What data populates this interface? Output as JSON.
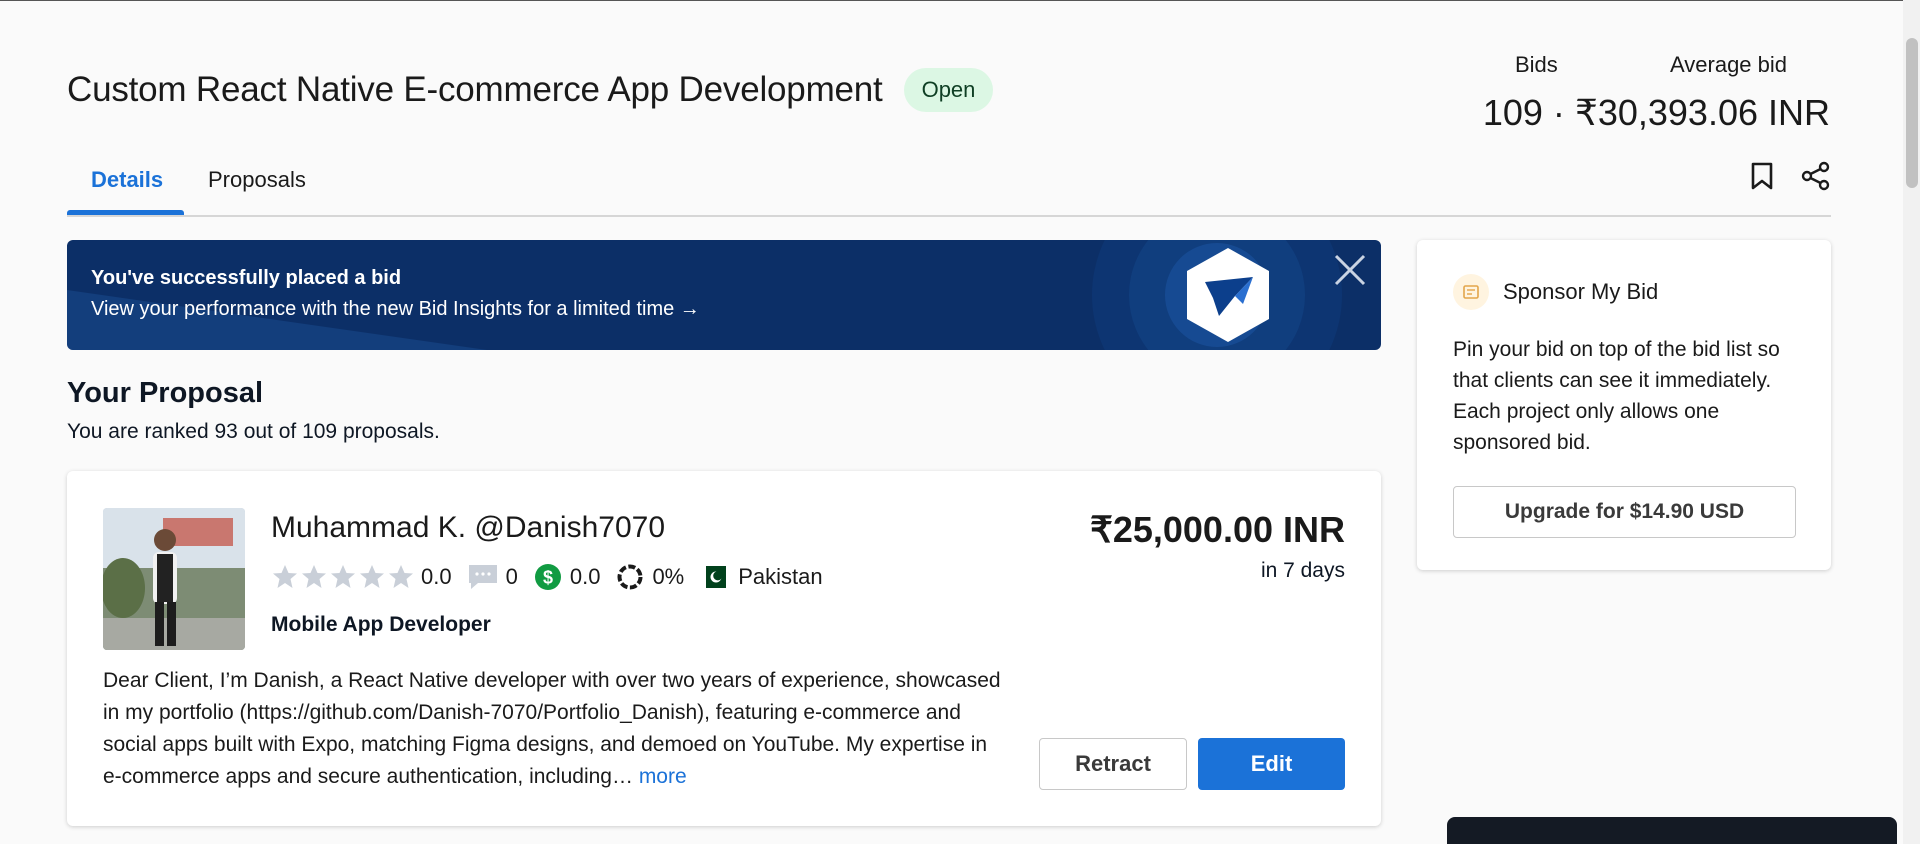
{
  "project": {
    "title": "Custom React Native E-commerce App Development",
    "status": "Open"
  },
  "stats": {
    "bids_label": "Bids",
    "avg_label": "Average bid",
    "bids_count": "109",
    "separator": "·",
    "avg_value": "₹30,393.06 INR"
  },
  "tabs": [
    {
      "label": "Details",
      "active": true
    },
    {
      "label": "Proposals",
      "active": false
    }
  ],
  "banner": {
    "title": "You've successfully placed a bid",
    "subtitle": "View your performance with the new Bid Insights for a limited time →"
  },
  "proposal": {
    "heading": "Your Proposal",
    "rank_text": "You are ranked 93 out of 109 proposals."
  },
  "bid": {
    "name": "Muhammad K.",
    "username": "@Danish7070",
    "rating": "0.0",
    "reviews": "0",
    "earnings": "0.0",
    "completion": "0%",
    "country": "Pakistan",
    "role": "Mobile App Developer",
    "price": "₹25,000.00 INR",
    "delivery": "in 7 days",
    "description": "Dear Client, I’m Danish, a React Native developer with over two years of experience, showcased in my portfolio (https://github.com/Danish-7070/Portfolio_Danish), featuring e-commerce and social apps built with Expo, matching Figma designs, and demoed on YouTube. My expertise in e-commerce apps and secure authentication, including…",
    "more_label": "more",
    "retract_label": "Retract",
    "edit_label": "Edit"
  },
  "sponsor": {
    "title": "Sponsor My Bid",
    "description": "Pin your bid on top of the bid list so that clients can see it immediately. Each project only allows one sponsored bid.",
    "button_label": "Upgrade for $14.90 USD"
  },
  "colors": {
    "accent": "#1b72d8",
    "banner_bg": "#0c2f67",
    "status_bg": "#dcf7e4",
    "earnings_green": "#119b42"
  },
  "icons": [
    "bookmark-icon",
    "share-icon",
    "close-icon",
    "freelancer-logo-icon",
    "star-icon",
    "chat-icon",
    "dollar-icon",
    "completion-ring-icon",
    "pakistan-flag-icon",
    "sponsor-icon"
  ]
}
